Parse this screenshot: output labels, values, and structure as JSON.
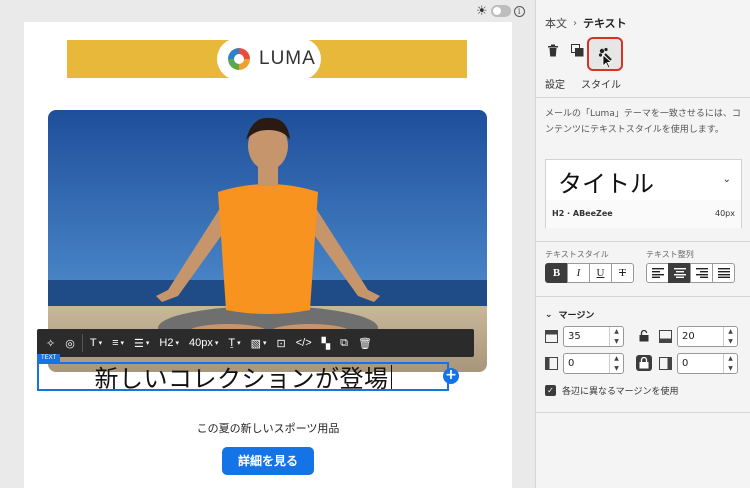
{
  "canvas": {
    "brand_name": "LUMA",
    "toolbar": {
      "heading_level": "H2",
      "font_size": "40px"
    },
    "text_block_tag": "TEXT",
    "headline": "新しいコレクションが登場",
    "subheadline": "この夏の新しいスポーツ用品",
    "cta_label": "詳細を見る"
  },
  "panel": {
    "breadcrumb": {
      "parent": "本文",
      "current": "テキスト"
    },
    "tabs": {
      "settings": "設定",
      "style": "スタイル"
    },
    "description": "メールの「Luma」テーマを一致させるには、コンテンツにテキストスタイルを使用します。",
    "text_style_preset": {
      "preview": "タイトル",
      "meta_left": "H2 · ABeeZee",
      "meta_right": "40px"
    },
    "text_style_label": "テキストスタイル",
    "text_align_label": "テキスト整列",
    "format_buttons": [
      "B",
      "I",
      "U",
      "T"
    ],
    "margin": {
      "label": "マージン",
      "top": "35",
      "bottom": "20",
      "left": "0",
      "right": "0",
      "different_per_side_label": "各辺に異なるマージンを使用"
    }
  },
  "colors": {
    "accent": "#1473e6",
    "banner": "#e8b83a",
    "highlight": "#d93025"
  }
}
